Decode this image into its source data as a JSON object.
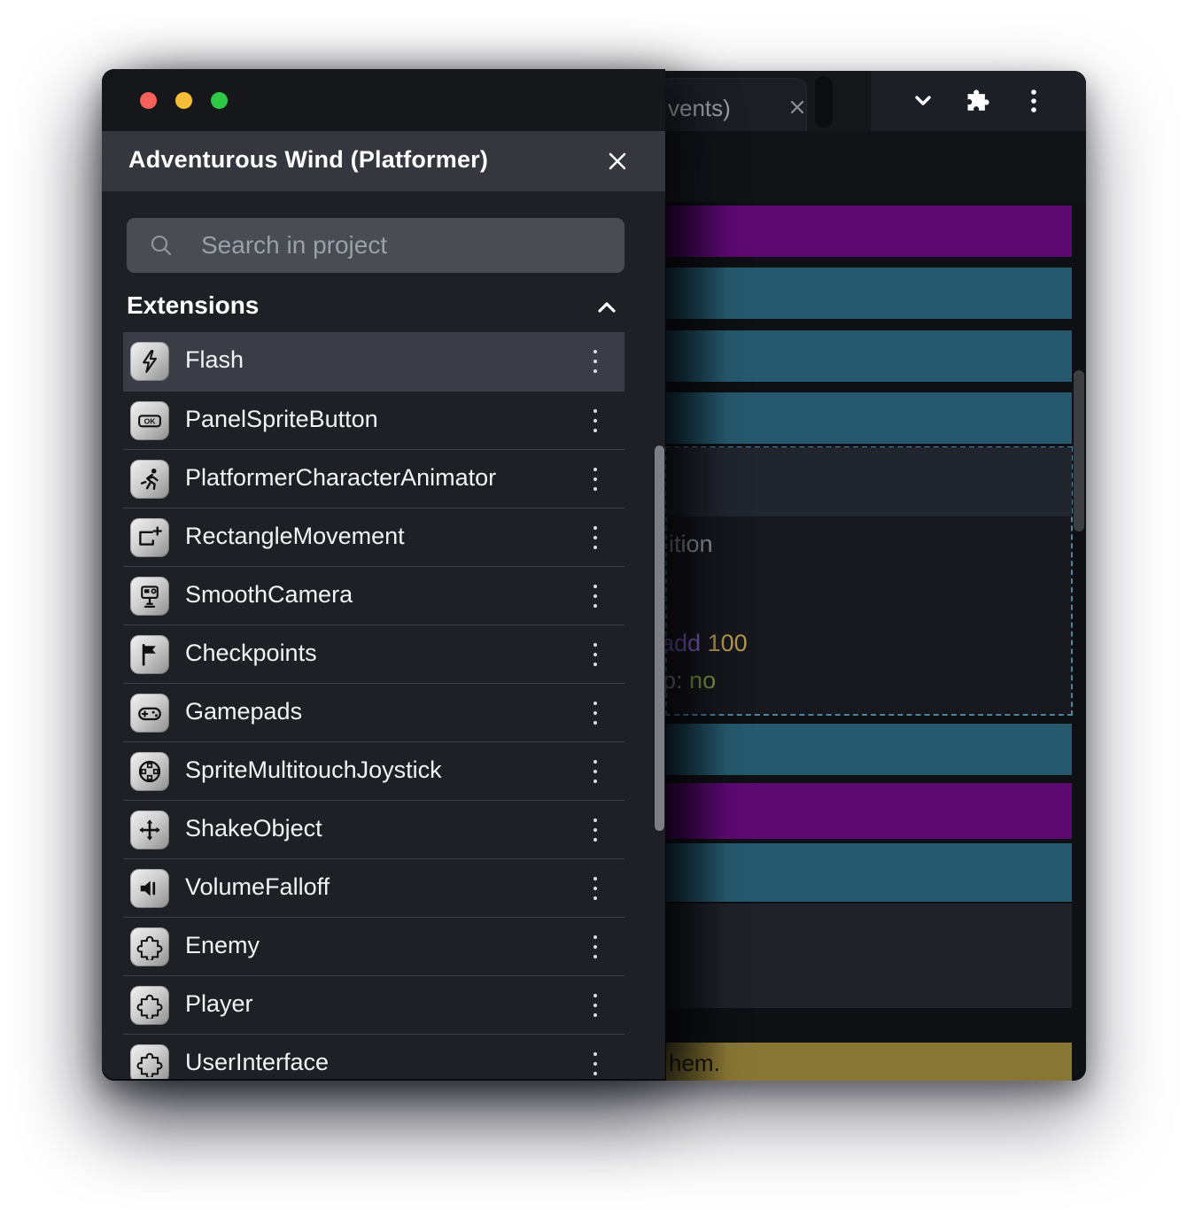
{
  "window": {
    "traffic_lights": [
      "close",
      "minimize",
      "maximize"
    ],
    "tab": {
      "label_fragment": "vents)",
      "close_icon": "×"
    },
    "titlebar": {
      "icons": [
        "chevron-down-icon",
        "extensions-puzzle-icon",
        "kebab-menu-icon"
      ]
    },
    "toolbar": {
      "icons": [
        "add-event-icon",
        "add-comment-icon",
        "add-circle-icon",
        "trash-icon",
        "undo-icon",
        "redo-icon",
        "search-icon"
      ]
    }
  },
  "drawer": {
    "title": "Adventurous Wind (Platformer)",
    "search": {
      "placeholder": "Search in project"
    },
    "section_header": "Extensions",
    "extensions": [
      {
        "label": "Flash",
        "icon": "flash-icon"
      },
      {
        "label": "PanelSpriteButton",
        "icon": "ok-button-icon"
      },
      {
        "label": "PlatformerCharacterAnimator",
        "icon": "runner-icon"
      },
      {
        "label": "RectangleMovement",
        "icon": "rectangle-plus-icon"
      },
      {
        "label": "SmoothCamera",
        "icon": "camera-icon"
      },
      {
        "label": "Checkpoints",
        "icon": "flag-icon"
      },
      {
        "label": "Gamepads",
        "icon": "gamepad-icon"
      },
      {
        "label": "SpriteMultitouchJoystick",
        "icon": "joystick-icon"
      },
      {
        "label": "ShakeObject",
        "icon": "move-arrows-icon"
      },
      {
        "label": "VolumeFalloff",
        "icon": "speaker-icon"
      },
      {
        "label": "Enemy",
        "icon": "puzzle-icon"
      },
      {
        "label": "Player",
        "icon": "puzzle-icon"
      },
      {
        "label": "UserInterface",
        "icon": "puzzle-icon"
      }
    ]
  },
  "events": {
    "fragments": {
      "condition": "ition",
      "add_kw": "add",
      "add_val": "100",
      "prop": "p:",
      "prop_val": "no",
      "bottom": "hem."
    },
    "colors": {
      "purple": "#5c0a71",
      "teal": "#26596d",
      "olive": "#877634",
      "selection_border": "#4d84a0"
    }
  }
}
